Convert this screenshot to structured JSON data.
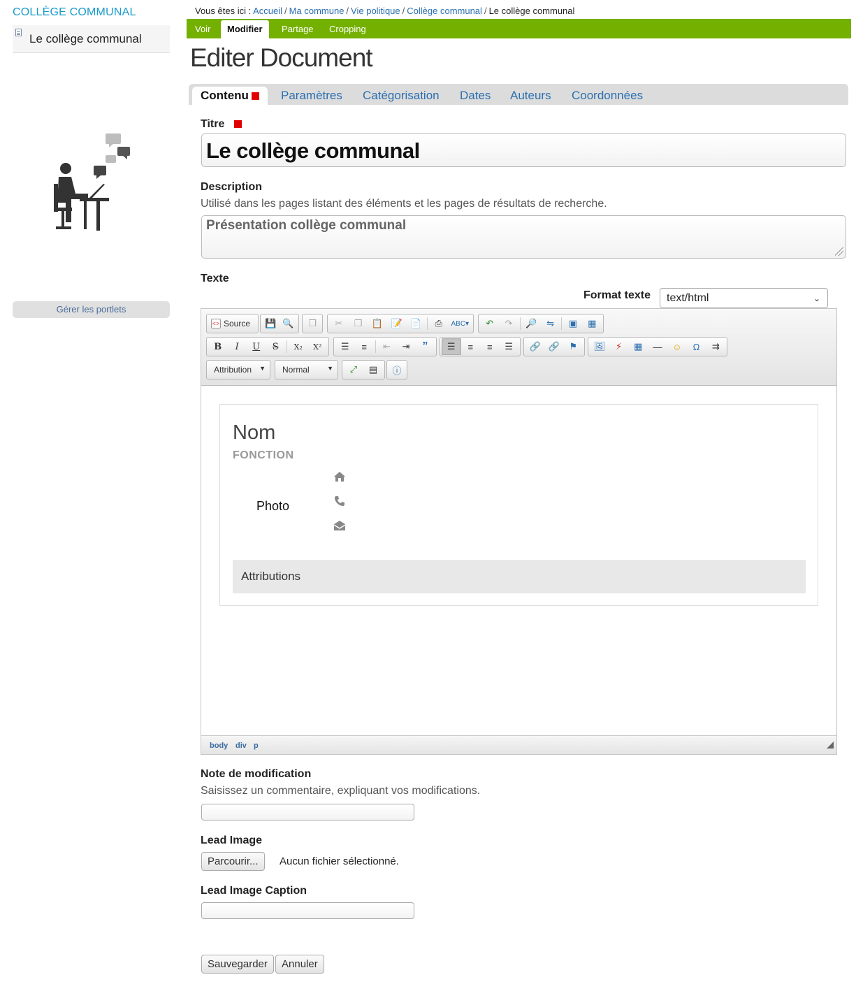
{
  "sidebar": {
    "portlet_title": "COLLÈGE COMMUNAL",
    "current_item": "Le collège communal",
    "manage_portlets": "Gérer les portlets"
  },
  "breadcrumb": {
    "prefix": "Vous êtes ici :",
    "links": [
      "Accueil",
      "Ma commune",
      "Vie politique",
      "Collège communal"
    ],
    "current": "Le collège communal"
  },
  "actions": {
    "tabs": [
      "Voir",
      "Modifier",
      "Partage",
      "Cropping"
    ],
    "active": "Modifier"
  },
  "page_title": "Editer Document",
  "form_tabs": {
    "items": [
      "Contenu",
      "Paramètres",
      "Catégorisation",
      "Dates",
      "Auteurs",
      "Coordonnées"
    ],
    "active": "Contenu"
  },
  "fields": {
    "title": {
      "label": "Titre",
      "value": "Le collège communal"
    },
    "description": {
      "label": "Description",
      "help": "Utilisé dans les pages listant des éléments et les pages de résultats de recherche.",
      "value": "Présentation collège communal"
    },
    "text": {
      "label": "Texte",
      "format_label": "Format texte",
      "format_value": "text/html"
    },
    "change_note": {
      "label": "Note de modification",
      "help": "Saisissez un commentaire, expliquant vos modifications.",
      "value": ""
    },
    "lead_image": {
      "label": "Lead Image",
      "browse_button": "Parcourir...",
      "no_file": "Aucun fichier sélectionné."
    },
    "lead_image_caption": {
      "label": "Lead Image Caption",
      "value": ""
    }
  },
  "editor": {
    "source_label": "Source",
    "style_combo": "Attribution",
    "format_combo": "Normal",
    "elements_path": [
      "body",
      "div",
      "p"
    ],
    "content": {
      "nom": "Nom",
      "fonction": "FONCTION",
      "photo": "Photo",
      "icons": [
        "home-icon",
        "phone-icon",
        "envelope-icon"
      ],
      "attributions": "Attributions"
    }
  },
  "buttons": {
    "save": "Sauvegarder",
    "cancel": "Annuler"
  },
  "colors": {
    "action_bar": "#74b000",
    "link": "#2b6fb0",
    "required": "#e10000",
    "portlet_title": "#1a9ccc"
  }
}
